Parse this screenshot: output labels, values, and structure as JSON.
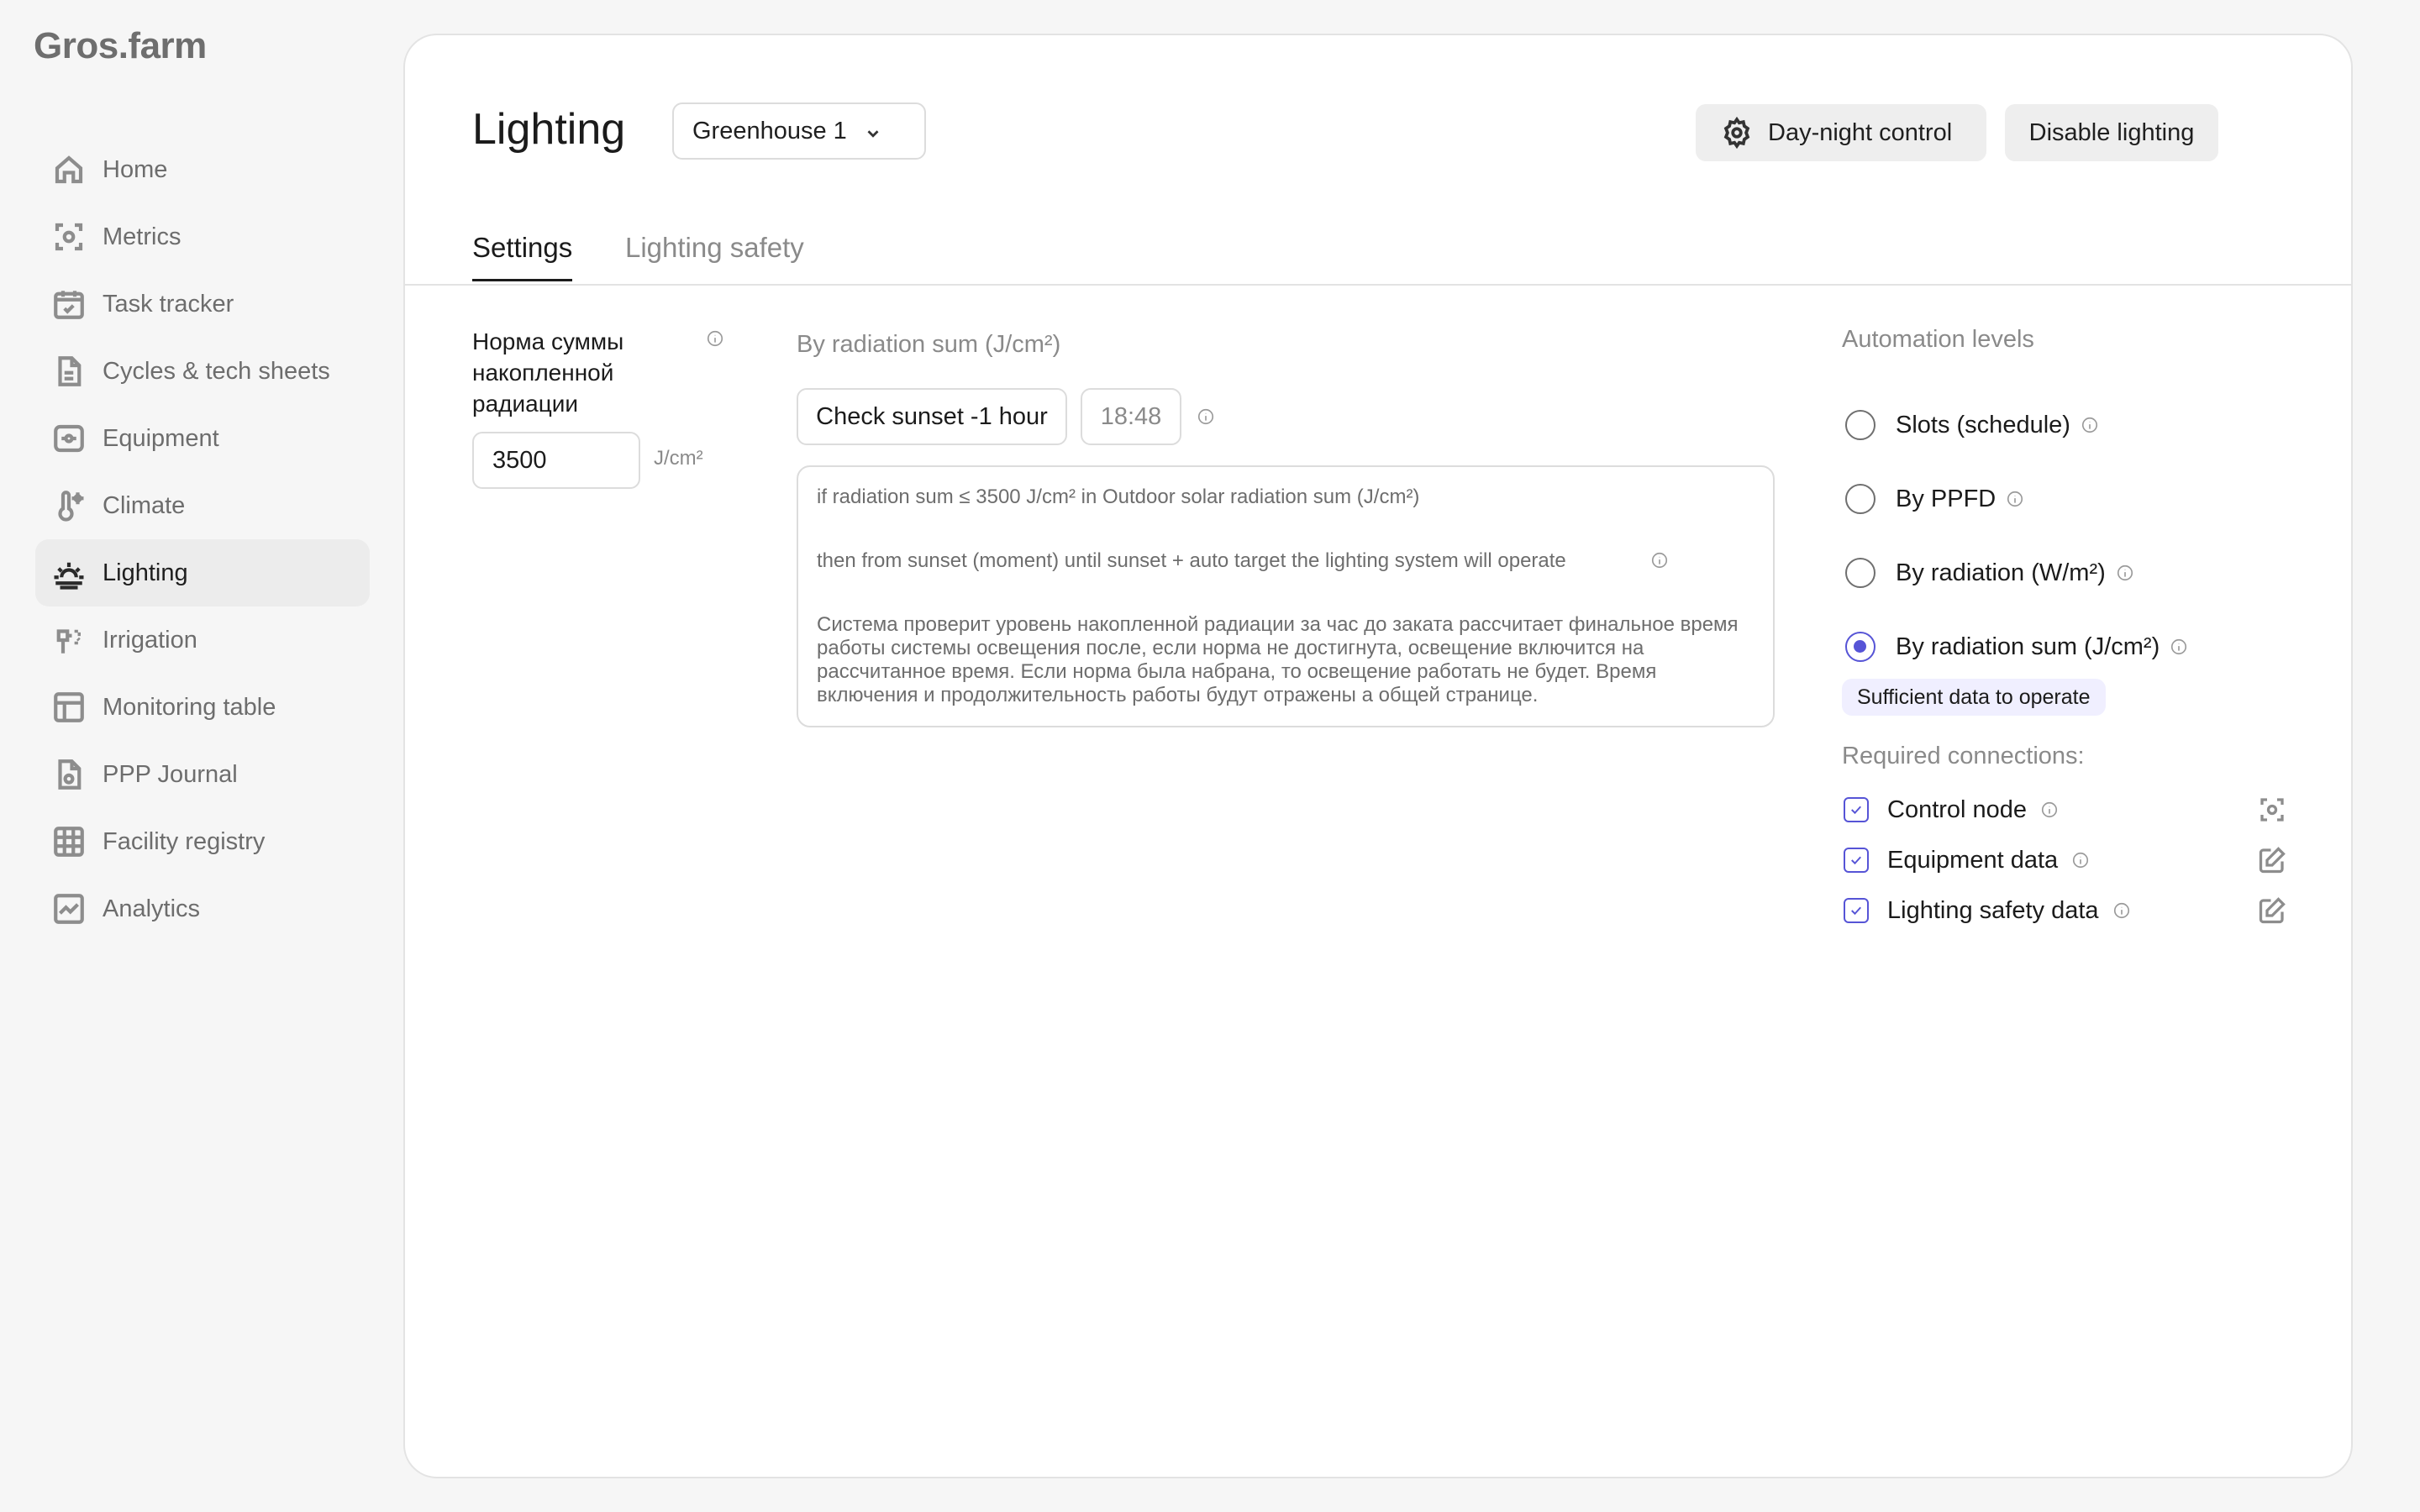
{
  "app": {
    "logo": "Gros.farm"
  },
  "sidebar": {
    "items": [
      {
        "label": "Home",
        "icon": "home-icon"
      },
      {
        "label": "Metrics",
        "icon": "metrics-icon"
      },
      {
        "label": "Task tracker",
        "icon": "calendar-check-icon"
      },
      {
        "label": "Cycles & tech sheets",
        "icon": "document-icon"
      },
      {
        "label": "Equipment",
        "icon": "equipment-icon"
      },
      {
        "label": "Climate",
        "icon": "thermometer-icon"
      },
      {
        "label": "Lighting",
        "icon": "sunrise-icon",
        "active": true
      },
      {
        "label": "Irrigation",
        "icon": "sprinkler-icon"
      },
      {
        "label": "Monitoring table",
        "icon": "table-icon"
      },
      {
        "label": "PPP Journal",
        "icon": "journal-icon"
      },
      {
        "label": "Facility registry",
        "icon": "grid-icon"
      },
      {
        "label": "Analytics",
        "icon": "chart-icon"
      }
    ]
  },
  "header": {
    "title": "Lighting",
    "greenhouse_select": "Greenhouse 1",
    "day_night_label": "Day-night control",
    "disable_label": "Disable lighting"
  },
  "tabs": [
    {
      "label": "Settings",
      "active": true
    },
    {
      "label": "Lighting safety",
      "active": false
    }
  ],
  "norm": {
    "label": "Норма суммы накопленной радиации",
    "value": "3500",
    "unit": "J/cm²"
  },
  "radiation": {
    "title": "By radiation sum (J/cm²)",
    "check_button": "Check sunset -1 hour",
    "time": "18:48",
    "rule_line1": "if radiation sum ≤ 3500 J/cm² in Outdoor solar radiation sum (J/cm²)",
    "rule_line2": "then from sunset (moment) until sunset + auto target the lighting system will operate",
    "description": "Система проверит  уровень накопленной радиации за час до заката рассчитает финальное время работы системы освещения после, если норма не достигнута, освещение включится на рассчитанное время. Если норма была набрана, то освещение работать не будет. Время включения и продолжительность работы будут отражены а общей странице."
  },
  "automation": {
    "title": "Automation levels",
    "options": [
      {
        "label": "Slots (schedule)",
        "checked": false
      },
      {
        "label": "By PPFD",
        "checked": false
      },
      {
        "label": "By radiation (W/m²)",
        "checked": false
      },
      {
        "label": "By radiation sum (J/cm²)",
        "checked": true
      }
    ],
    "status_badge": "Sufficient data to operate",
    "required_title": "Required connections:",
    "connections": [
      {
        "label": "Control node",
        "checked": true,
        "action_icon": "node-icon"
      },
      {
        "label": "Equipment data",
        "checked": true,
        "action_icon": "edit-icon"
      },
      {
        "label": "Lighting safety data",
        "checked": true,
        "action_icon": "edit-icon"
      }
    ]
  },
  "colors": {
    "accent": "#5654d6",
    "badge_bg": "#f0efff",
    "active_nav_bg": "#ececec"
  }
}
